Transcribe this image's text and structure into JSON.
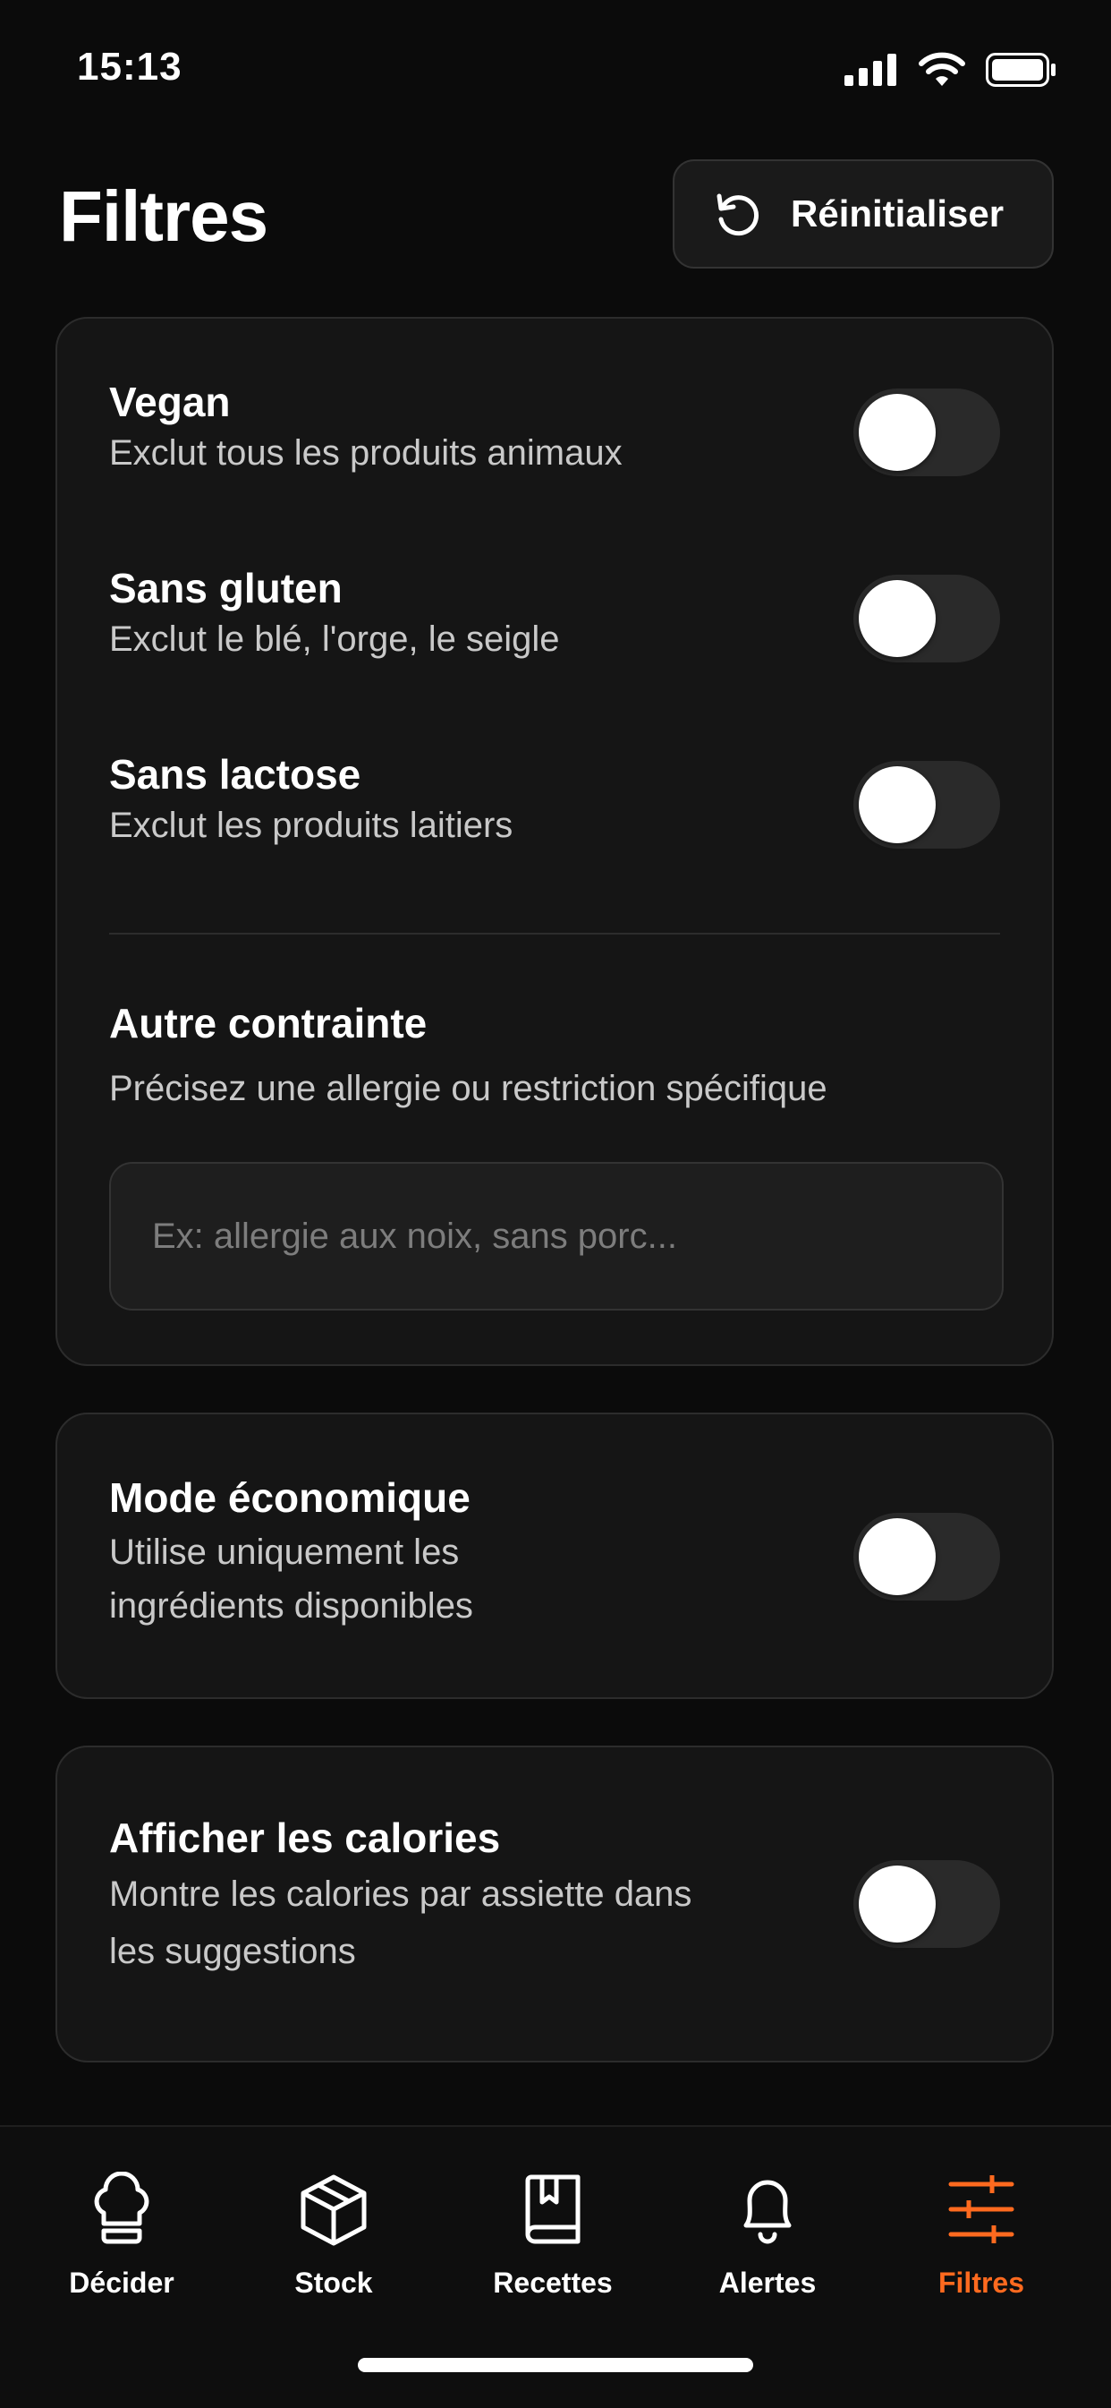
{
  "status_bar": {
    "time": "15:13"
  },
  "header": {
    "title": "Filtres",
    "reset_label": "Réinitialiser"
  },
  "diet_card": {
    "items": [
      {
        "title": "Vegan",
        "desc": "Exclut tous les produits animaux",
        "enabled": false
      },
      {
        "title": "Sans gluten",
        "desc": "Exclut le blé, l'orge, le seigle",
        "enabled": false
      },
      {
        "title": "Sans lactose",
        "desc": "Exclut les produits laitiers",
        "enabled": false
      }
    ],
    "other": {
      "title": "Autre contrainte",
      "desc": "Précisez une allergie ou restriction spécifique",
      "placeholder": "Ex: allergie aux noix, sans porc...",
      "value": ""
    }
  },
  "economy_card": {
    "title": "Mode économique",
    "desc_line1": "Utilise uniquement les",
    "desc_line2": "ingrédients disponibles",
    "enabled": false
  },
  "calories_card": {
    "title": "Afficher les calories",
    "desc_line1": "Montre les calories par assiette dans",
    "desc_line2": "les suggestions",
    "enabled": false
  },
  "tabbar": {
    "active": "Filtres",
    "accent_color": "#ff6a1f",
    "tabs": [
      {
        "label": "Décider",
        "icon": "chef-hat-icon"
      },
      {
        "label": "Stock",
        "icon": "box-icon"
      },
      {
        "label": "Recettes",
        "icon": "book-icon"
      },
      {
        "label": "Alertes",
        "icon": "bell-icon"
      },
      {
        "label": "Filtres",
        "icon": "sliders-icon"
      }
    ]
  }
}
